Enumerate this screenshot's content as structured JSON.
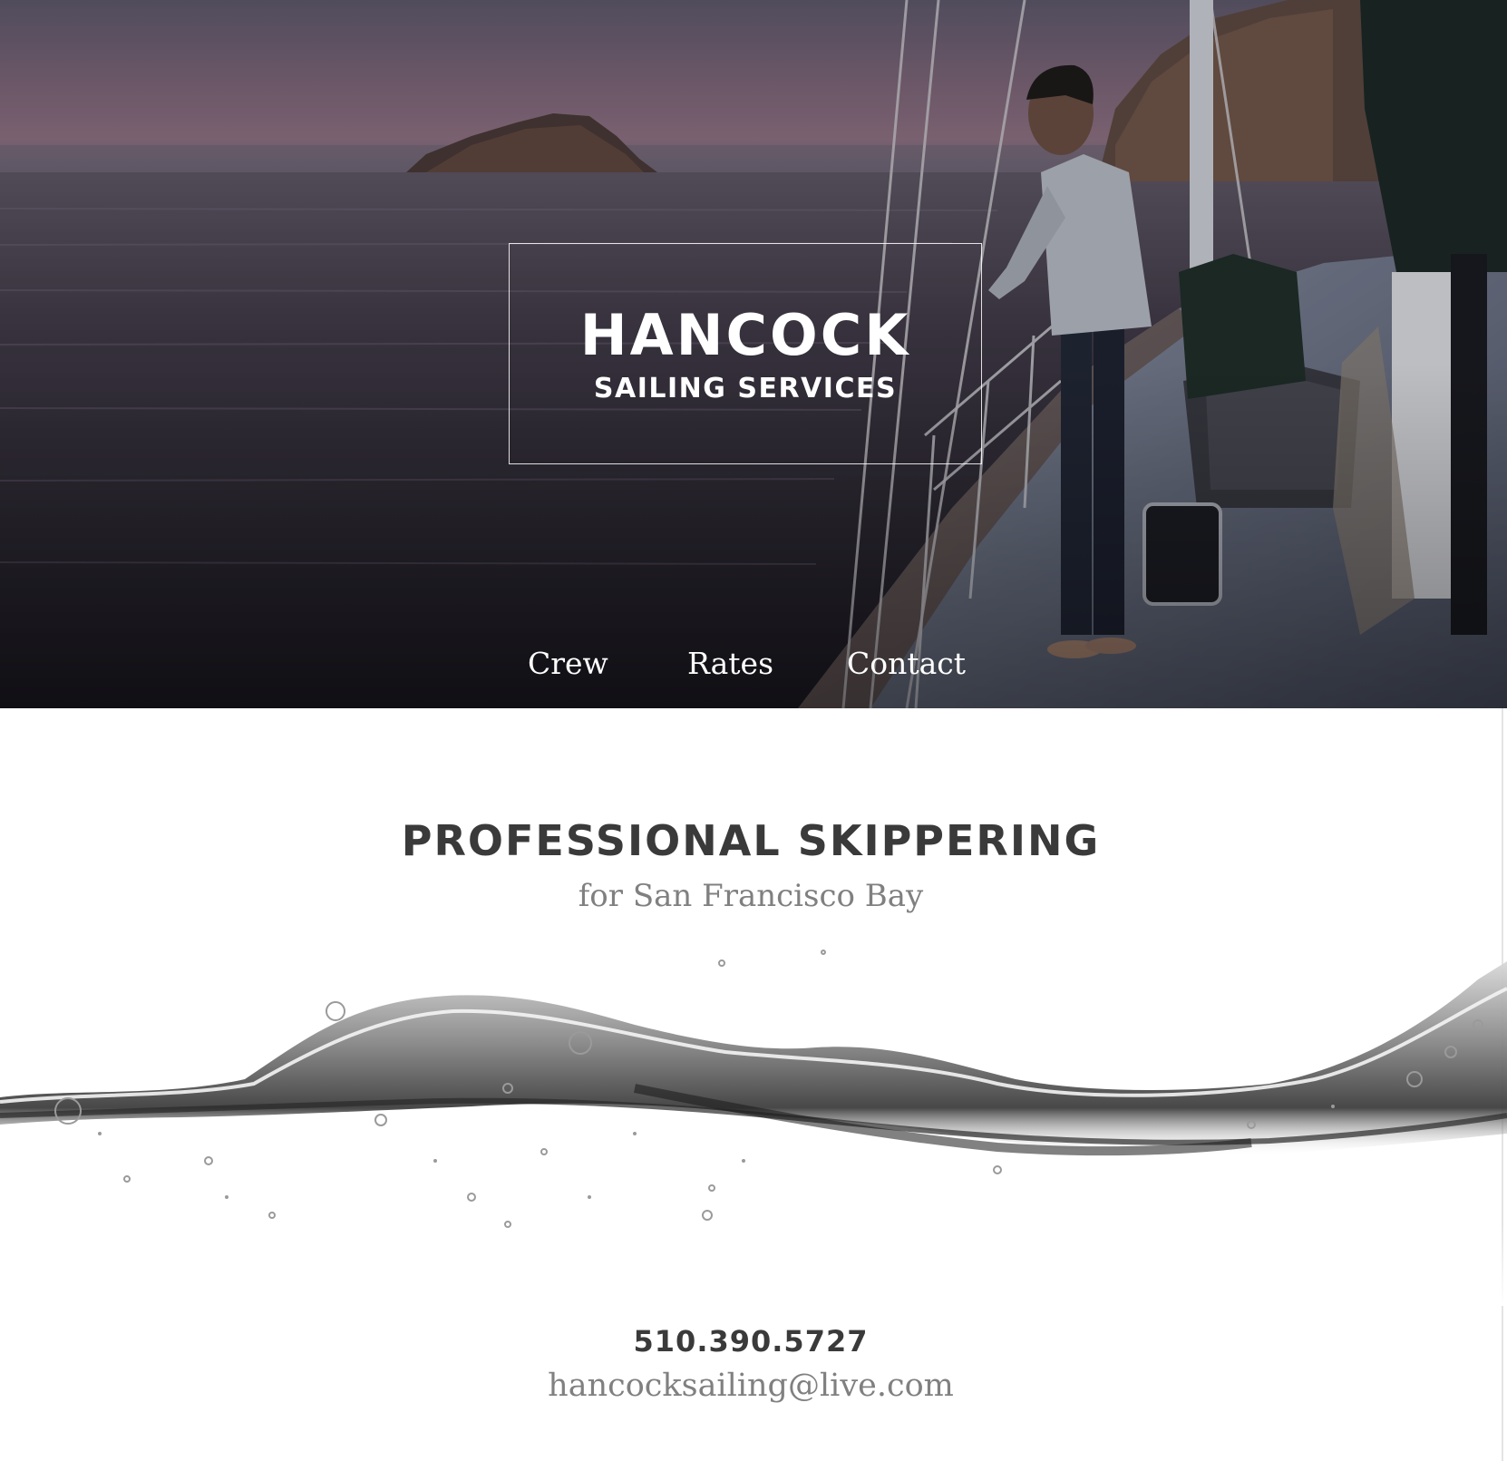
{
  "hero": {
    "logo": {
      "title": "HANCOCK",
      "subtitle": "SAILING SERVICES"
    },
    "nav": [
      {
        "label": "Crew"
      },
      {
        "label": "Rates"
      },
      {
        "label": "Contact"
      }
    ]
  },
  "main": {
    "headline": "PROFESSIONAL SKIPPERING",
    "subheadline": "for San Francisco Bay",
    "phone": "510.390.5727",
    "email": "hancocksailing@live.com"
  },
  "colors": {
    "heading_text": "#3a3a3a",
    "muted_text": "#808080",
    "hero_overlay_text": "#ffffff"
  }
}
